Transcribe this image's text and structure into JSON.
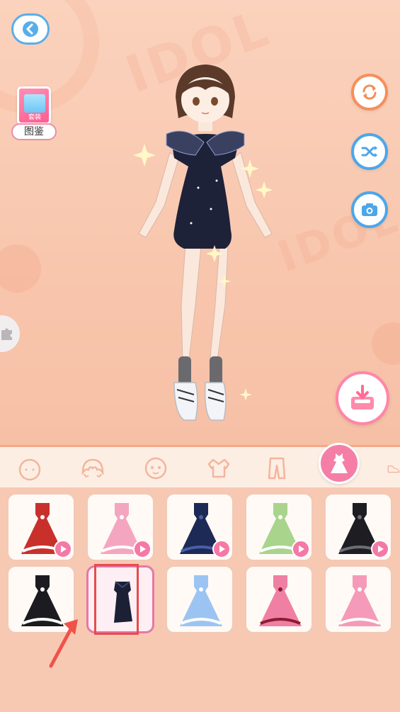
{
  "screen": {
    "album_label": "图鉴",
    "album_cover_tag": "套装",
    "bg_word": "IDOL"
  },
  "toolbar": {
    "back": "back-icon",
    "reset": "refresh-icon",
    "shuffle": "shuffle-icon",
    "camera": "camera-icon",
    "save": "download-icon"
  },
  "categories": [
    {
      "name": "face",
      "icon": "face-icon",
      "active": false
    },
    {
      "name": "hair",
      "icon": "hair-icon",
      "active": false
    },
    {
      "name": "makeup",
      "icon": "makeup-face-icon",
      "active": false
    },
    {
      "name": "top",
      "icon": "top-icon",
      "active": false
    },
    {
      "name": "pants",
      "icon": "pants-icon",
      "active": false
    },
    {
      "name": "dress",
      "icon": "dress-icon",
      "active": true
    }
  ],
  "items": [
    {
      "id": "red-white-gown",
      "colors": [
        "#c9302c",
        "#ffffff"
      ],
      "video": true,
      "selected": false
    },
    {
      "id": "pink-ribbon-dress",
      "colors": [
        "#f4a6c0",
        "#ffffff"
      ],
      "video": true,
      "selected": false
    },
    {
      "id": "navy-star-gown",
      "colors": [
        "#1d2a55",
        "#4a5ea8"
      ],
      "video": true,
      "selected": false
    },
    {
      "id": "green-white-dress",
      "colors": [
        "#a9d48c",
        "#ffffff"
      ],
      "video": true,
      "selected": false
    },
    {
      "id": "black-mermaid-gown",
      "colors": [
        "#1d1d22",
        "#6d6d78"
      ],
      "video": true,
      "selected": false
    },
    {
      "id": "black-bow-dress",
      "colors": [
        "#1b1b20",
        "#ffffff"
      ],
      "video": false,
      "selected": false
    },
    {
      "id": "starry-mini-dress",
      "colors": [
        "#1b2035",
        "#3d4670"
      ],
      "video": false,
      "selected": true
    },
    {
      "id": "blue-sailor-dress",
      "colors": [
        "#9cc4f2",
        "#ffffff"
      ],
      "video": false,
      "selected": false
    },
    {
      "id": "pink-maroon-dress",
      "colors": [
        "#f07fa4",
        "#8a1d33"
      ],
      "video": false,
      "selected": false
    },
    {
      "id": "pink-plaid-dress",
      "colors": [
        "#f59ab8",
        "#ffffff"
      ],
      "video": false,
      "selected": false
    }
  ],
  "annotation": {
    "highlight_color": "#e84b4b",
    "arrow_color": "#f0524a"
  }
}
